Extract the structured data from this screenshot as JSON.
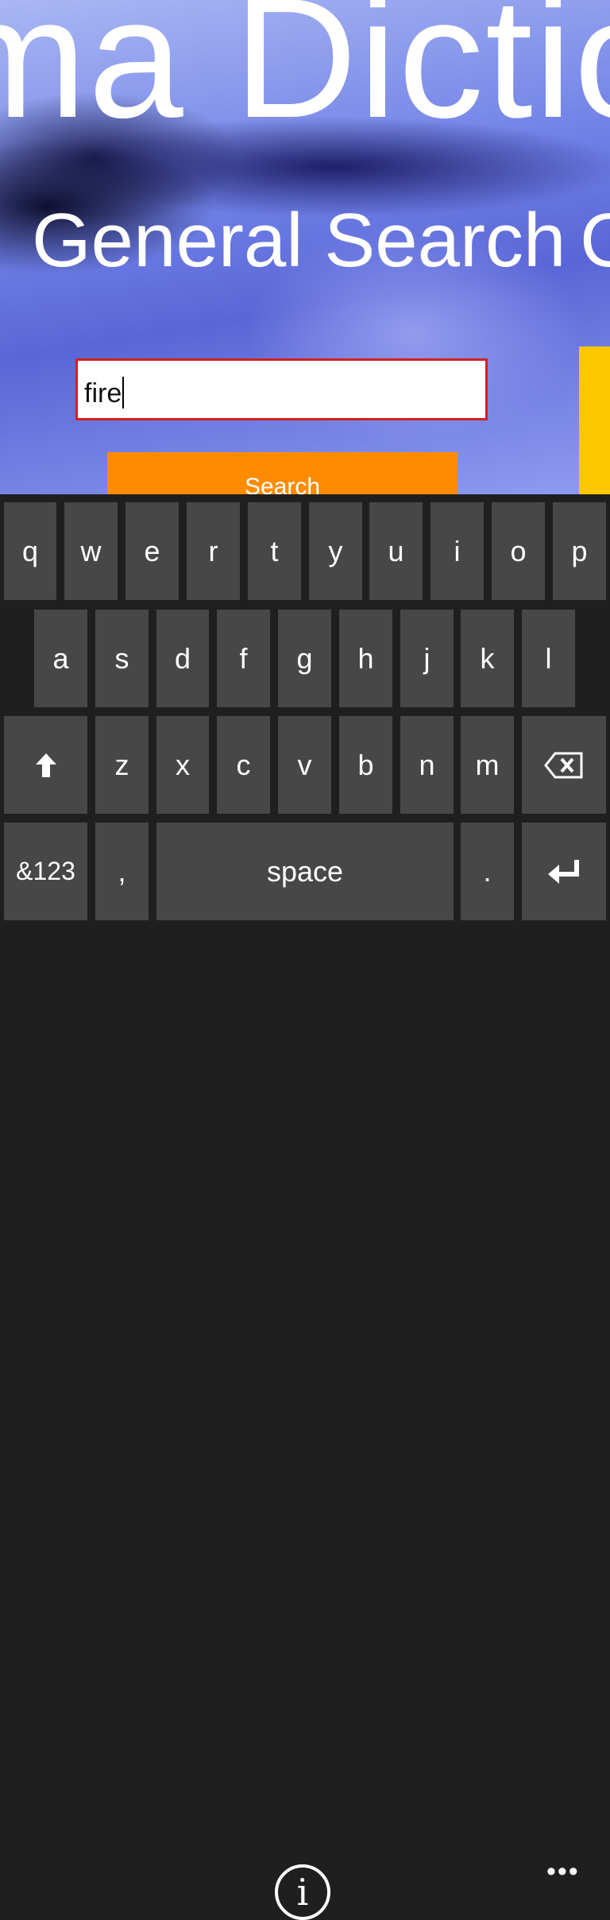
{
  "app": {
    "panorama_title": "ma Dictio",
    "section_title": "General Search",
    "next_section_peek": "C",
    "search_value": "fire",
    "search_button": "Search"
  },
  "keyboard": {
    "row1": [
      "q",
      "w",
      "e",
      "r",
      "t",
      "y",
      "u",
      "i",
      "o",
      "p"
    ],
    "row2": [
      "a",
      "s",
      "d",
      "f",
      "g",
      "h",
      "j",
      "k",
      "l"
    ],
    "row3": [
      "z",
      "x",
      "c",
      "v",
      "b",
      "n",
      "m"
    ],
    "numbers_key": "&123",
    "comma_key": ",",
    "space_key": "space",
    "period_key": ".",
    "shift_icon": "shift-arrow-up-icon",
    "backspace_icon": "backspace-icon",
    "enter_icon": "enter-icon"
  },
  "bottom_bar": {
    "info_icon": "info-icon",
    "more_icon": "more-ellipsis-icon",
    "more_label": "•••"
  },
  "colors": {
    "search_button": "#ff8c00",
    "input_border": "#d51f1f",
    "side_tile": "#ffc700",
    "key": "#474747",
    "keyboard_bg": "#1f1f1f"
  }
}
